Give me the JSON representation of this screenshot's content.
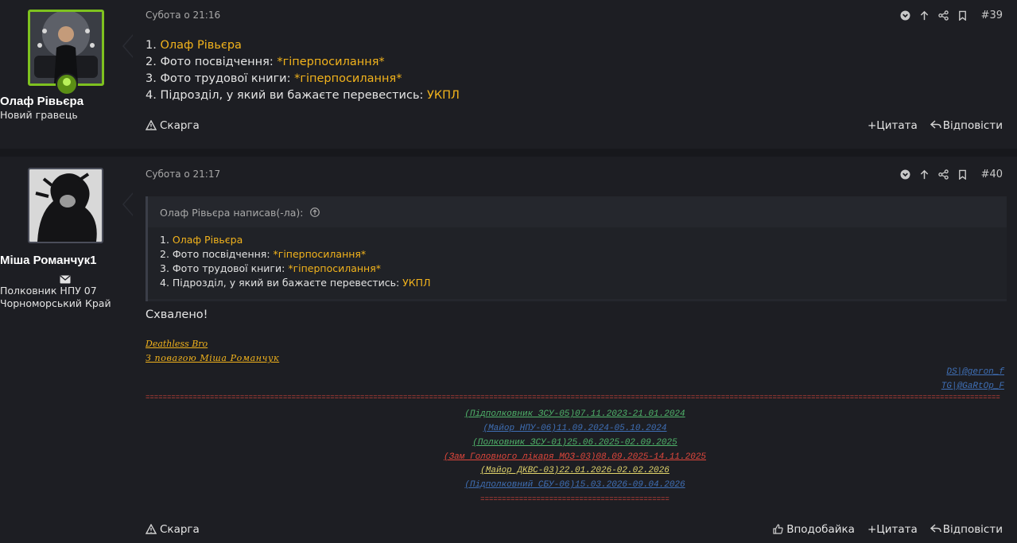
{
  "posts": [
    {
      "author": "Олаф Рівьєра",
      "user_title": "Новий гравець",
      "date": "Субота о 21:16",
      "number": "#39",
      "lines": [
        {
          "label": "1. ",
          "value": "Олаф Рівьєра"
        },
        {
          "label": "2. Фото посвідчення: ",
          "value": "*гіперпосилання*"
        },
        {
          "label": "3. Фото трудової книги: ",
          "value": "*гіперпосилання*"
        },
        {
          "label": "4. Підрозділ, у який ви бажаєте перевестись: ",
          "value": "УКПЛ"
        }
      ],
      "report": "Скарга",
      "quote_action": "Цитата",
      "reply_action": "Відповісти"
    },
    {
      "author": "Міша Романчук1",
      "user_title_1": "Полковник НПУ 07",
      "user_title_2": "Чорноморський Край",
      "date": "Субота о 21:17",
      "number": "#40",
      "quote_header": "Олаф Рівьєра написав(-ла):",
      "quote_lines": [
        {
          "label": "1. ",
          "value": "Олаф Рівьєра"
        },
        {
          "label": "2. Фото посвідчення: ",
          "value": "*гіперпосилання*"
        },
        {
          "label": "3. Фото трудової книги: ",
          "value": "*гіперпосилання*"
        },
        {
          "label": "4. Підрозділ, у який ви бажаєте перевестись: ",
          "value": "УКПЛ"
        }
      ],
      "message": "Схвалено!",
      "signature": {
        "line1": "Deathless Bro",
        "line2": "З повагою Міша Романчук",
        "ds": "DS|@geron_f",
        "tg": "TG|@GaRtOp_F",
        "separator": "==================================================================================================================================================================================================================",
        "history": [
          {
            "text": "(Підполковник ЗСУ-05)07.11.2023-21.01.2024",
            "color": "#4fb36a"
          },
          {
            "text": "(Майор НПУ-06)11.09.2024-05.10.2024",
            "color": "#3f6fb5"
          },
          {
            "text": "(Полковник ЗСУ-01)25.06.2025-02.09.2025",
            "color": "#4fb36a"
          },
          {
            "text": "(Зам Головного лікаря МОЗ-03)08.09.2025-14.11.2025",
            "color": "#e0473c"
          },
          {
            "text": "(Майор ДКВС-03)22.01.2026-02.02.2026",
            "color": "#e0d36b"
          },
          {
            "text": "(Підполковний СБУ-06)15.03.2026-09.04.2026",
            "color": "#3f6fb5"
          }
        ],
        "separator_short": "============================================"
      },
      "report": "Скарга",
      "like_action": "Вподобайка",
      "quote_action": "Цитата",
      "reply_action": "Відповісти"
    }
  ]
}
